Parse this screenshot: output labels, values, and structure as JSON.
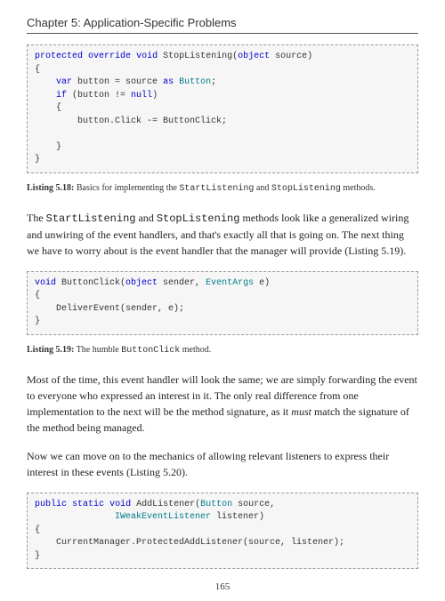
{
  "header": {
    "chapter": "Chapter 5: Application-Specific Problems"
  },
  "code1": {
    "l1a": "protected",
    "l1b": "override",
    "l1c": "void",
    "l1d": " StopListening(",
    "l1e": "object",
    "l1f": " source)",
    "l2": "{",
    "l3a": "    ",
    "l3b": "var",
    "l3c": " button = source ",
    "l3d": "as",
    "l3e": " ",
    "l3f": "Button",
    "l3g": ";",
    "l4a": "    ",
    "l4b": "if",
    "l4c": " (button != ",
    "l4d": "null",
    "l4e": ")",
    "l5": "    {",
    "l6": "        button.Click -= ButtonClick;",
    "l7": "",
    "l8": "    }",
    "l9": "}"
  },
  "cap1": {
    "label": "Listing 5.18:",
    "t1": "  Basics for implementing the ",
    "m1": "StartListening",
    "t2": " and ",
    "m2": "StopListening",
    "t3": " methods."
  },
  "para1": {
    "t1": "The ",
    "m1": "StartListening",
    "t2": " and ",
    "m2": "StopListening",
    "t3": " methods look like a generalized wiring and unwiring of the event handlers, and that's exactly all that is going on. The next thing we have to worry about is the event handler that the manager will provide (Listing 5.19)."
  },
  "code2": {
    "l1a": "void",
    "l1b": " ButtonClick(",
    "l1c": "object",
    "l1d": " sender, ",
    "l1e": "EventArgs",
    "l1f": " e)",
    "l2": "{",
    "l3": "    DeliverEvent(sender, e);",
    "l4": "}"
  },
  "cap2": {
    "label": "Listing 5.19:",
    "t1": "  The humble ",
    "m1": "ButtonClick",
    "t2": " method."
  },
  "para2": {
    "t1": "Most of the time, this event handler will look the same; we are simply forwarding the event to everyone who expressed an interest in it. The only real difference from one implementation to the next will be the method signature, as it ",
    "em": "must",
    "t2": " match the signature of the method being managed."
  },
  "para3": {
    "t1": "Now we can move on to the mechanics of allowing relevant listeners to express their interest in these events (Listing 5.20)."
  },
  "code3": {
    "l1a": "public",
    "l1b": " ",
    "l1c": "static",
    "l1d": " ",
    "l1e": "void",
    "l1f": " AddListener(",
    "l1g": "Button",
    "l1h": " source,",
    "l2a": "               ",
    "l2b": "IWeakEventListener",
    "l2c": " listener)",
    "l3": "{",
    "l4": "    CurrentManager.ProtectedAddListener(source, listener);",
    "l5": "}"
  },
  "footer": {
    "page": "165"
  }
}
